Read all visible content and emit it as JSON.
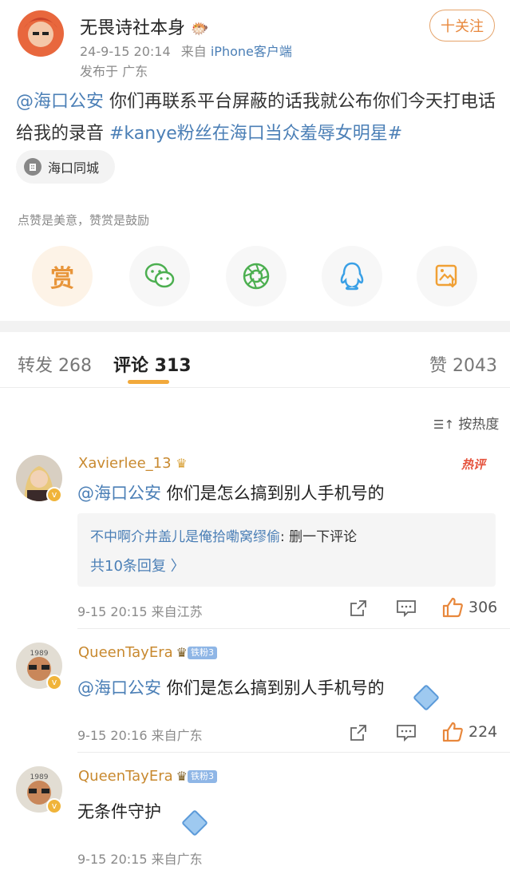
{
  "post": {
    "author": "无畏诗社本身",
    "date": "24-9-15 20:14",
    "source_prefix": "来自",
    "source": "iPhone客户端",
    "location_line": "发布于 广东",
    "follow_label": "十关注",
    "text_mention": "@海口公安",
    "text_body_1": " 你们再联系平台屏蔽的话我就公布你们今天打电话",
    "text_body_2": "给我的录音 ",
    "text_hashtag": "#kanye粉丝在海口当众羞辱女明星#",
    "location_chip": "海口同城",
    "reward_hint": "点赞是美意，赞赏是鼓励",
    "actions": [
      {
        "name": "reward",
        "label": "赏",
        "icon": "reward-icon"
      },
      {
        "name": "wechat",
        "icon": "wechat-icon"
      },
      {
        "name": "moments",
        "icon": "moments-icon"
      },
      {
        "name": "qq",
        "icon": "qq-icon"
      },
      {
        "name": "save-image",
        "icon": "save-image-icon"
      }
    ]
  },
  "tabs": {
    "repost": "转发 268",
    "comments": "评论 313",
    "likes": "赞 2043"
  },
  "sort_label": "按热度",
  "comments": [
    {
      "name": "Xavierlee_13",
      "text_mention": "@海口公安",
      "text_body": " 你们是怎么搞到别人手机号的",
      "hot_tag": "热评",
      "reply_author": "不中啊介井盖儿是俺拾嘞窝缪偷",
      "reply_text": ": 删一下评论",
      "reply_count": "共10条回复 〉",
      "time": "9-15 20:15",
      "location": "来自江苏",
      "likes": "306"
    },
    {
      "name": "QueenTayEra",
      "badge": "铁粉3",
      "text_mention": "@海口公安",
      "text_body": " 你们是怎么搞到别人手机号的",
      "time": "9-15 20:16",
      "location": "来自广东",
      "likes": "224"
    },
    {
      "name": "QueenTayEra",
      "badge": "铁粉3",
      "text_body": "无条件守护",
      "time": "9-15 20:15",
      "location": "来自广东"
    }
  ],
  "colors": {
    "accent": "#f2a93b",
    "link": "#4b7fb6",
    "name_gold": "#c8892f",
    "hot_red": "#e5533d"
  }
}
